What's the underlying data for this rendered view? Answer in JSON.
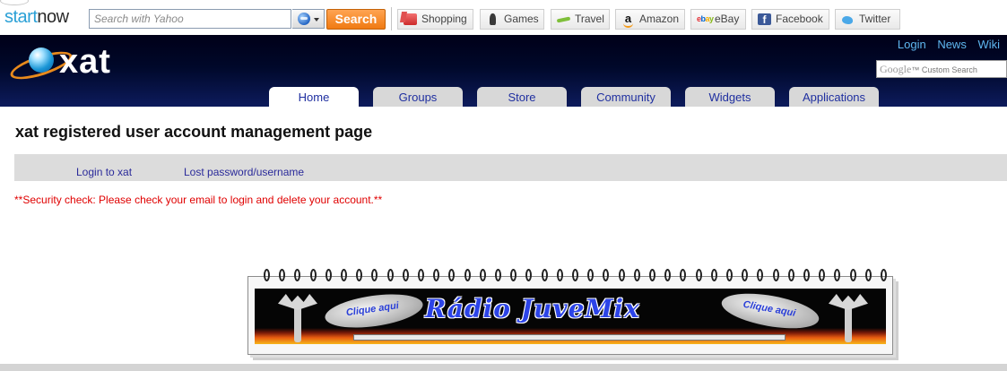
{
  "toolbar": {
    "brand_part1": "start",
    "brand_part2": "now",
    "search_placeholder": "Search with Yahoo",
    "search_button": "Search",
    "buttons": [
      {
        "label": "Shopping",
        "icon": "shopping-icon"
      },
      {
        "label": "Games",
        "icon": "games-icon"
      },
      {
        "label": "Travel",
        "icon": "travel-icon"
      },
      {
        "label": "Amazon",
        "icon": "amazon-icon"
      },
      {
        "label": "eBay",
        "icon": "ebay-icon"
      },
      {
        "label": "Facebook",
        "icon": "facebook-icon"
      },
      {
        "label": "Twitter",
        "icon": "twitter-icon"
      }
    ]
  },
  "header": {
    "logo_text": "xat",
    "links": [
      "Login",
      "News",
      "Wiki"
    ],
    "google_word": "Google",
    "google_suffix": "™ Custom Search",
    "tabs": [
      "Home",
      "Groups",
      "Store",
      "Community",
      "Widgets",
      "Applications"
    ],
    "active_tab": "Home"
  },
  "main": {
    "title": "xat registered user account management page",
    "subnav": [
      "Login to xat",
      "Lost password/username"
    ],
    "warning": "**Security check: Please check your email to login and delete your account.**"
  },
  "banner": {
    "title": "Rádio JuveMix",
    "left_bubble": "Clique aqui",
    "right_bubble": "Clique aqui"
  },
  "colors": {
    "header_bg": "#000018",
    "tab_text": "#1f2fa0",
    "link": "#5fb8f0",
    "warning": "#e00000",
    "search_button": "#f07a12"
  }
}
